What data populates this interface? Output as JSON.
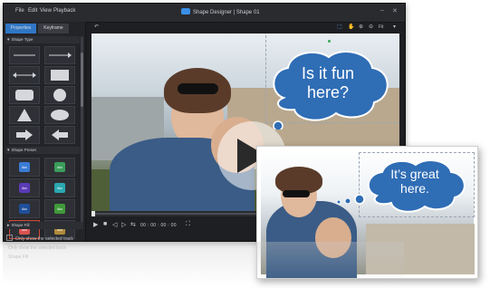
{
  "menu": [
    "File",
    "Edit",
    "View",
    "Playback"
  ],
  "window_title": "Shape Designer | Shape 01",
  "tabs": [
    "Properties",
    "Keyframe"
  ],
  "sections": {
    "shape_type": "Shape Type",
    "shape_preset": "Shape Preset",
    "shape_fill": "Shape Fill"
  },
  "preset_label": "Abc",
  "footer": {
    "only_show_selected": "Only show the selected track"
  },
  "toolbar": {
    "fit": "Fit"
  },
  "playback": {
    "timecode": "00 : 00 : 00 : 00"
  },
  "bubble_main": "Is it fun here?",
  "bubble_front": "It’s great here.",
  "reflection_lines": [
    "Only show the selected track",
    "Shape Fill"
  ],
  "colors": {
    "accent": "#2f76c5",
    "bubble": "#2f6db5",
    "bubble_dark": "#1d4f8c"
  }
}
